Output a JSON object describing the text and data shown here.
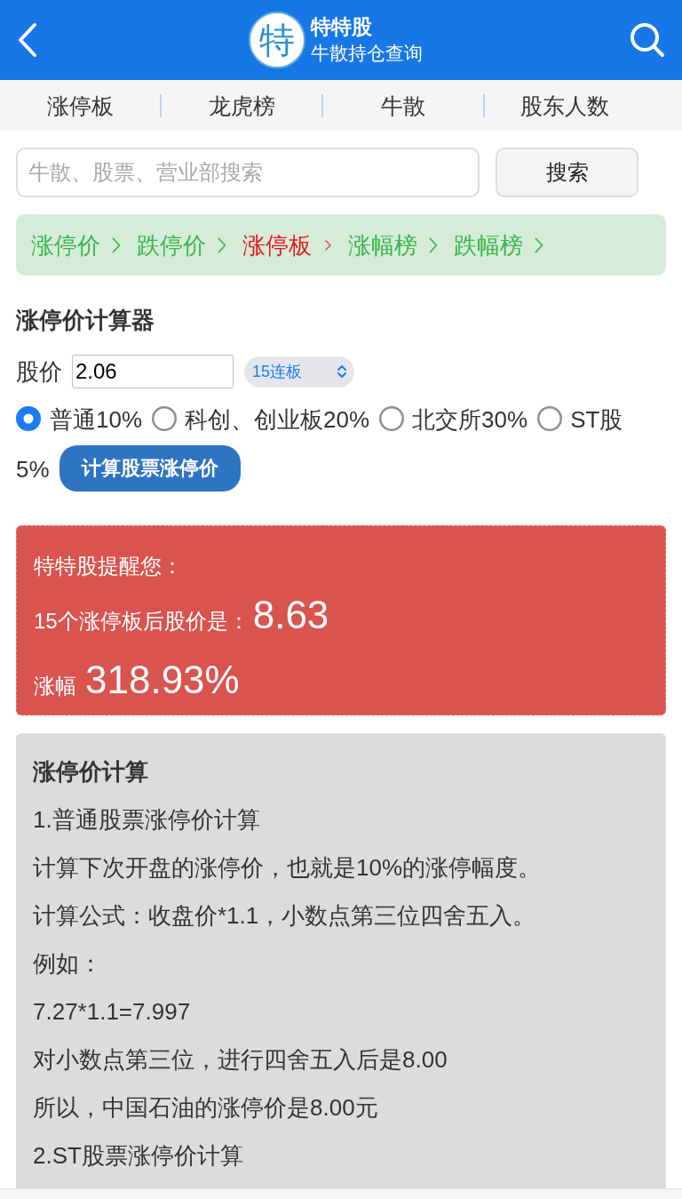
{
  "header": {
    "logo_text": "特",
    "title": "特特股",
    "subtitle": "牛散持仓查询"
  },
  "nav_tabs": [
    {
      "label": "涨停板"
    },
    {
      "label": "龙虎榜"
    },
    {
      "label": "牛散"
    },
    {
      "label": "股东人数"
    }
  ],
  "search": {
    "placeholder": "牛散、股票、营业部搜索",
    "button": "搜索"
  },
  "breadcrumb": [
    {
      "label": "涨停价",
      "selected": false
    },
    {
      "label": "跌停价",
      "selected": false
    },
    {
      "label": "涨停板",
      "selected": true
    },
    {
      "label": "涨幅榜",
      "selected": false
    },
    {
      "label": "跌幅榜",
      "selected": false
    }
  ],
  "calculator": {
    "title": "涨停价计算器",
    "price_label": "股价",
    "price_value": "2.06",
    "board_select": "15连板",
    "options": [
      {
        "label_lines": [
          "普通10%"
        ],
        "selected": true
      },
      {
        "label_lines": [
          "科创、创业板20%"
        ],
        "selected": false
      },
      {
        "label_lines": [
          "北交所30%"
        ],
        "selected": false
      },
      {
        "label_lines": [
          "ST股",
          "5%"
        ],
        "selected": false
      }
    ],
    "button": "计算股票涨停价"
  },
  "result": {
    "heading": "特特股提醒您：",
    "price_label": "15个涨停板后股价是：",
    "price_value": "8.63",
    "change_label": "涨幅",
    "change_value": "318.93%"
  },
  "info": {
    "title": "涨停价计算",
    "lines": [
      "1.普通股票涨停价计算",
      "计算下次开盘的涨停价，也就是10%的涨停幅度。",
      "计算公式：收盘价*1.1，小数点第三位四舍五入。",
      "例如：",
      "7.27*1.1=7.997",
      "对小数点第三位，进行四舍五入后是8.00",
      "所以，中国石油的涨停价是8.00元",
      "2.ST股票涨停价计算"
    ]
  }
}
